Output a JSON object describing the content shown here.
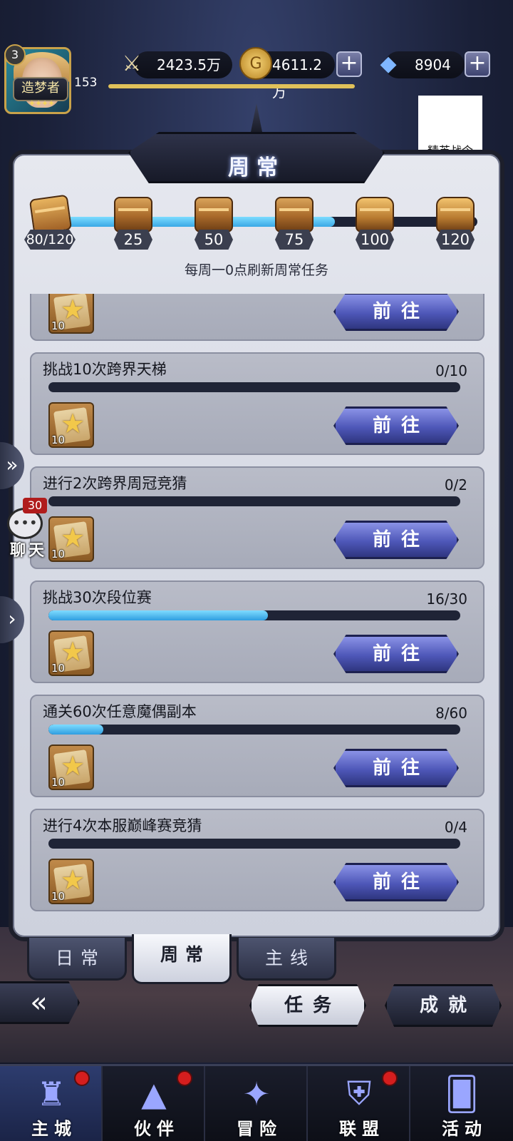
{
  "player": {
    "level_badge": "3",
    "level": "153",
    "title": "造梦者",
    "title_stars": "✦✦✦✦"
  },
  "resources": {
    "power": "2423.5万",
    "gold": "4611.2万",
    "diamonds": "8904",
    "plus": "+"
  },
  "elite_token": {
    "label": "精英战令"
  },
  "panel": {
    "title": "周常",
    "refresh_note": "每周一0点刷新周常任务",
    "progress_label": "80/120",
    "progress_fraction": 0.667,
    "milestones": [
      "25",
      "50",
      "75",
      "100",
      "120"
    ]
  },
  "tasks": [
    {
      "title": "",
      "count": "",
      "progress": null,
      "reward_qty": "10",
      "button": "前往"
    },
    {
      "title": "挑战10次跨界天梯",
      "count": "0/10",
      "progress": 0,
      "reward_qty": "10",
      "button": "前往"
    },
    {
      "title": "进行2次跨界周冠竞猜",
      "count": "0/2",
      "progress": 0,
      "reward_qty": "10",
      "button": "前往"
    },
    {
      "title": "挑战30次段位赛",
      "count": "16/30",
      "progress": 0.533,
      "reward_qty": "10",
      "button": "前往"
    },
    {
      "title": "通关60次任意魔偶副本",
      "count": "8/60",
      "progress": 0.133,
      "reward_qty": "10",
      "button": "前往"
    },
    {
      "title": "进行4次本服巅峰赛竞猜",
      "count": "0/4",
      "progress": 0,
      "reward_qty": "10",
      "button": "前往"
    }
  ],
  "tabs": [
    {
      "label": "日常",
      "active": false
    },
    {
      "label": "周常",
      "active": true
    },
    {
      "label": "主线",
      "active": false
    }
  ],
  "bottom_buttons": {
    "tasks": "任务",
    "achievements": "成就"
  },
  "chat": {
    "badge": "30",
    "label": "聊天"
  },
  "nav": [
    {
      "label": "主城",
      "icon": "castle-icon",
      "badge": true,
      "active": true
    },
    {
      "label": "伙伴",
      "icon": "witch-hat-icon",
      "badge": true,
      "active": false
    },
    {
      "label": "冒险",
      "icon": "compass-icon",
      "badge": false,
      "active": false
    },
    {
      "label": "联盟",
      "icon": "shield-crest-icon",
      "badge": true,
      "active": false
    },
    {
      "label": "活动",
      "icon": "cards-icon",
      "badge": false,
      "active": false
    }
  ],
  "colors": {
    "progress_blue": "#3aa8e6",
    "button_blue": "#4e57b8",
    "notify_red": "#d51e1e",
    "gold": "#e0c15a"
  }
}
